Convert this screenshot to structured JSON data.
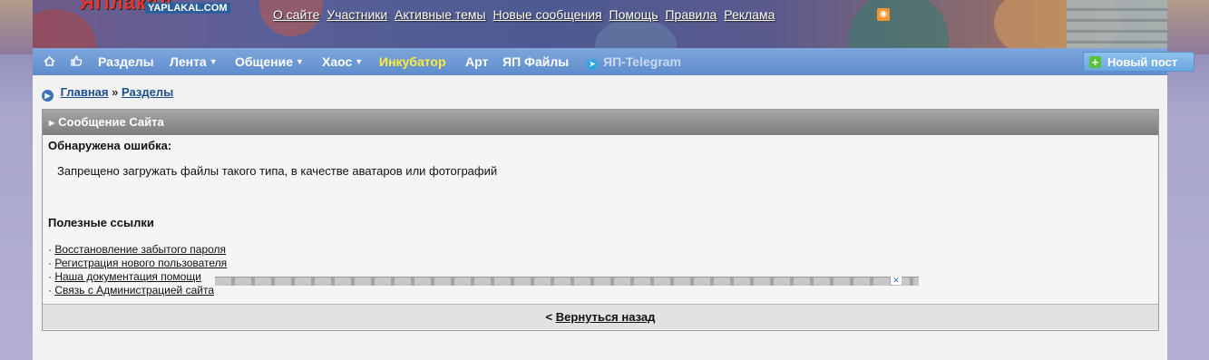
{
  "logo": {
    "brand_big": "ЯПлакал",
    "brand_small": "YAPLAKAL.COM"
  },
  "top_links": [
    "О сайте",
    "Участники",
    "Активные темы",
    "Новые сообщения",
    "Помощь",
    "Правила",
    "Реклама"
  ],
  "icons": {
    "home": "home-icon",
    "like": "thumbs-up-icon",
    "rss": "rss-icon",
    "telegram": "telegram-icon",
    "plus": "plus-icon",
    "breadcrumb": "arrow-circle-icon"
  },
  "nav": {
    "sections": "Разделы",
    "feed": "Лента",
    "social": "Общение",
    "chaos": "Хаос",
    "incubator": "Инкубатор",
    "art": "Арт",
    "files": "ЯП Файлы",
    "telegram": "ЯП-Telegram",
    "new_post": "Новый пост"
  },
  "breadcrumb": {
    "home": "Главная",
    "sep": "»",
    "sections": "Разделы"
  },
  "message": {
    "header": "Сообщение Сайта",
    "error_title": "Обнаружена ошибка:",
    "error_text": "Запрещено загружать файлы такого типа, в качестве аватаров или фотографий",
    "useful_title": "Полезные ссылки",
    "links": [
      "Восстановление забытого пароля",
      "Регистрация нового пользователя",
      "Наша документация помощи",
      "Связь с Администрацией сайта"
    ],
    "back_prefix": "<",
    "back": "Вернуться назад"
  },
  "colors": {
    "nav_bg": "#6a95d3",
    "incubator": "#ffeb3a",
    "link": "#1a4d8f",
    "box_head": "#8e8e8e"
  }
}
